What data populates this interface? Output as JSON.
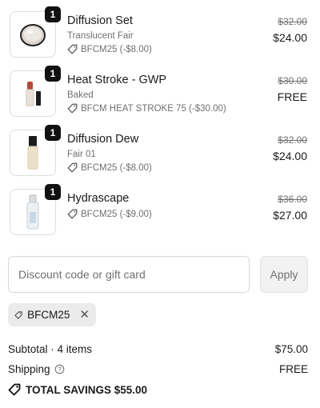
{
  "items": [
    {
      "name": "Diffusion Set",
      "variant": "Translucent Fair",
      "quantity": "1",
      "discount": "BFCM25 (-$8.00)",
      "original_price": "$32.00",
      "price": "$24.00"
    },
    {
      "name": "Heat Stroke - GWP",
      "variant": "Baked",
      "quantity": "1",
      "discount": "BFCM HEAT STROKE 75 (-$30.00)",
      "original_price": "$30.00",
      "price": "FREE"
    },
    {
      "name": "Diffusion Dew",
      "variant": "Fair 01",
      "quantity": "1",
      "discount": "BFCM25 (-$8.00)",
      "original_price": "$32.00",
      "price": "$24.00"
    },
    {
      "name": "Hydrascape",
      "quantity": "1",
      "discount": "BFCM25 (-$9.00)",
      "original_price": "$36.00",
      "price": "$27.00"
    }
  ],
  "discount": {
    "placeholder": "Discount code or gift card",
    "apply_label": "Apply",
    "applied_code": "BFCM25"
  },
  "summary": {
    "subtotal_label": "Subtotal · 4 items",
    "subtotal_value": "$75.00",
    "shipping_label": "Shipping",
    "shipping_value": "FREE",
    "savings_label": "TOTAL SAVINGS $55.00"
  },
  "icons": {
    "discount_tag": "tag-icon",
    "remove": "close-icon",
    "help": "help-circle-icon"
  }
}
